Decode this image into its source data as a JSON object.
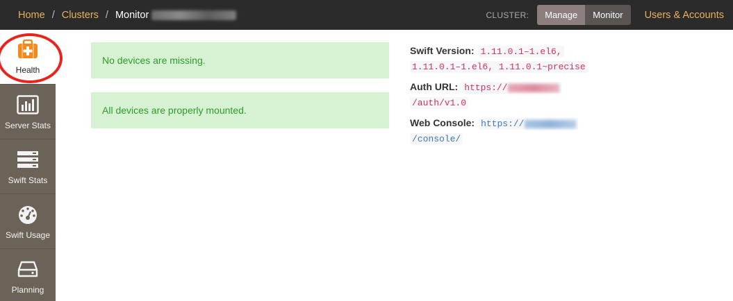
{
  "topbar": {
    "breadcrumbs": {
      "home": "Home",
      "clusters": "Clusters",
      "current": "Monitor",
      "separator": "/"
    },
    "cluster_label": "CLUSTER:",
    "manage_label": "Manage",
    "monitor_label": "Monitor",
    "users_label": "Users & Accounts"
  },
  "sidebar": {
    "items": [
      {
        "label": "Health",
        "icon": "medkit-icon"
      },
      {
        "label": "Server Stats",
        "icon": "bar-chart-icon"
      },
      {
        "label": "Swift Stats",
        "icon": "server-stack-icon"
      },
      {
        "label": "Swift Usage",
        "icon": "dashboard-gauge-icon"
      },
      {
        "label": "Planning",
        "icon": "hard-drive-icon"
      }
    ]
  },
  "alerts": {
    "missing": "No devices are missing.",
    "mounted": "All devices are properly mounted."
  },
  "info": {
    "swift_version_key": "Swift Version:",
    "swift_version_line1": "1.11.0.1–1.el6,",
    "swift_version_line2": "1.11.0.1–1.el6, 1.11.0.1~precise",
    "auth_url_key": "Auth URL:",
    "auth_url_prefix": "https://",
    "auth_url_suffix": "/auth/v1.0",
    "web_console_key": "Web Console:",
    "web_console_prefix": "https://",
    "web_console_suffix": "/console/"
  },
  "colors": {
    "topbar_bg": "#2b2b2b",
    "link_accent": "#e8b15c",
    "sidebar_bg": "#6b6358",
    "alert_bg": "#d6f2d3",
    "alert_text": "#2e9b2a",
    "annotation_red": "#e8241d"
  }
}
